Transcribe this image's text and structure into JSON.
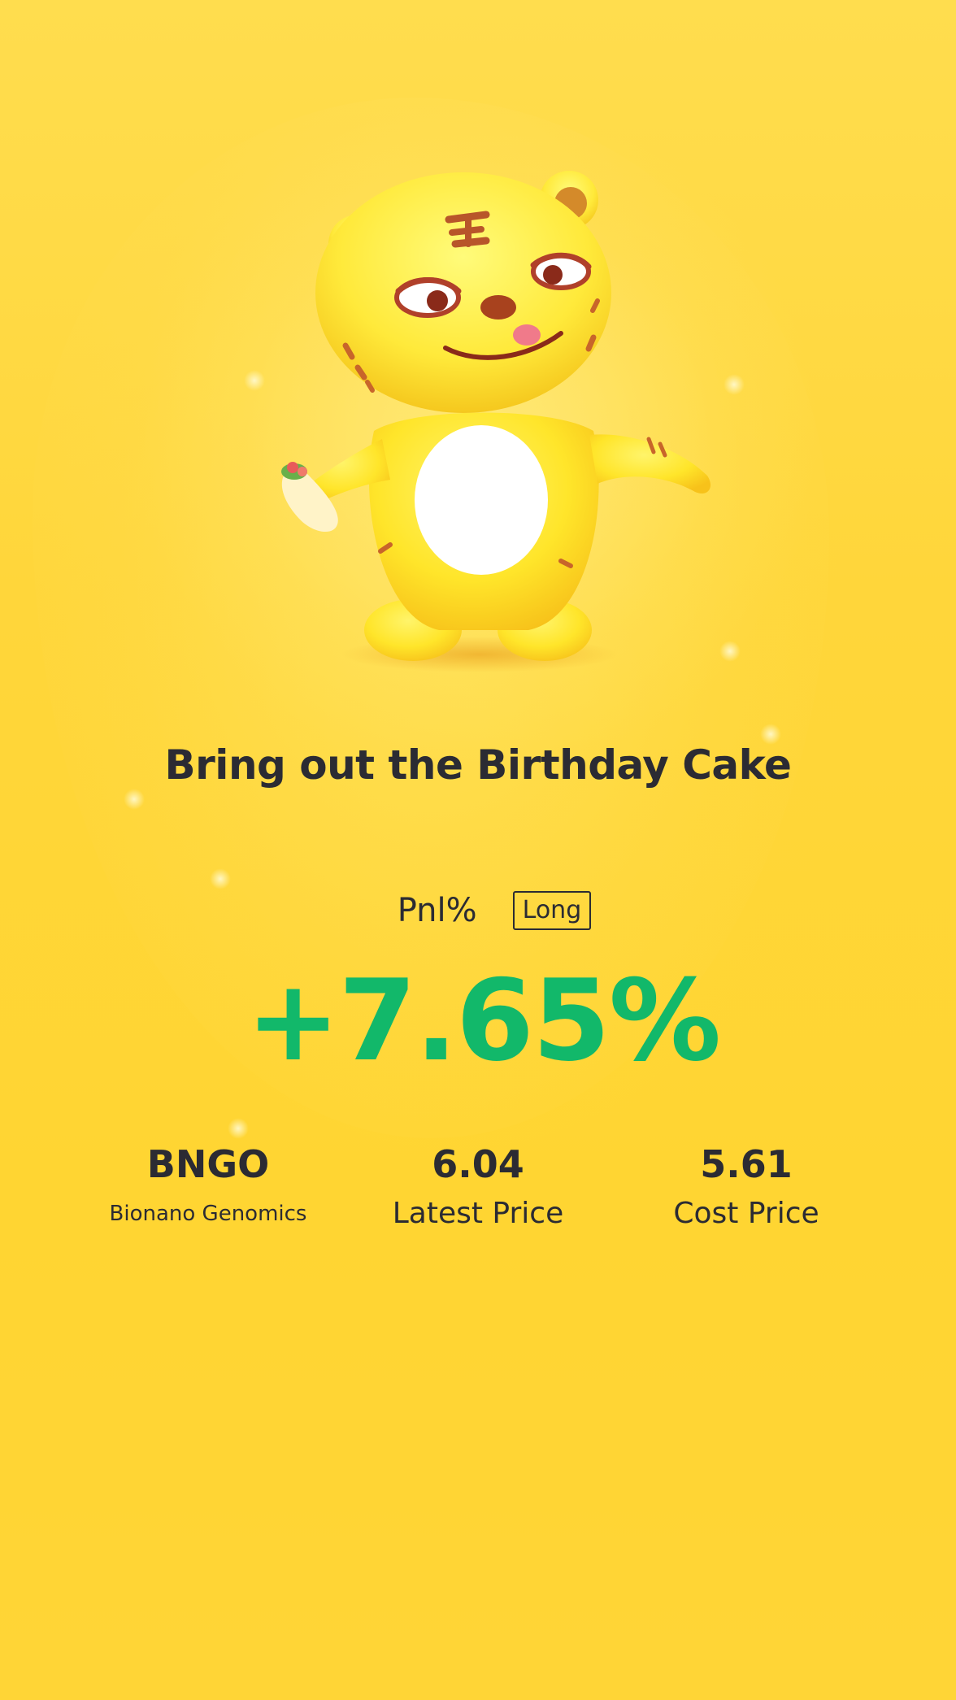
{
  "share_card": {
    "headline": "Bring out the Birthday Cake",
    "pnl": {
      "label": "Pnl%",
      "direction": "Long",
      "value": "+7.65%",
      "value_color": "#12b86a"
    },
    "stock": {
      "ticker": "BNGO",
      "company_name": "Bionano Genomics"
    },
    "latest_price": {
      "value": "6.04",
      "label": "Latest Price"
    },
    "cost_price": {
      "value": "5.61",
      "label": "Cost Price"
    },
    "illustration": "tiger-mascot-icon",
    "colors": {
      "background": "#ffd63a",
      "text": "#2b2b33",
      "positive": "#12b86a"
    }
  }
}
